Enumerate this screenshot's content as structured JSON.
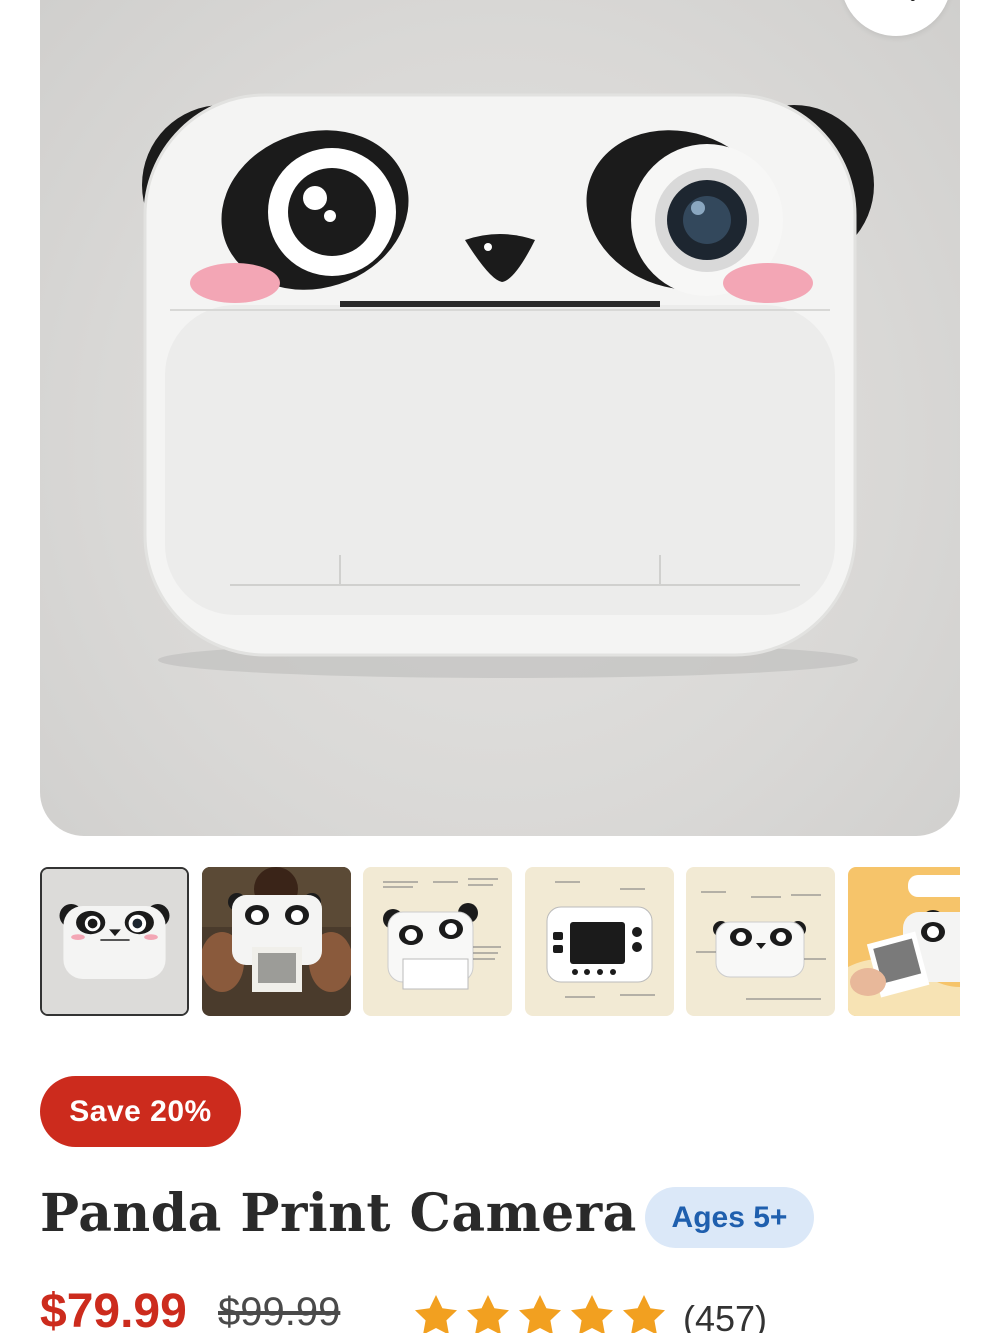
{
  "product": {
    "title": "Panda Print Camera",
    "save_badge": "Save 20%",
    "age_badge": "Ages 5+",
    "price": "$79.99",
    "compare_price": "$99.99",
    "rating": 5,
    "review_count": "(457)"
  },
  "gallery": {
    "thumbnail_count": 6,
    "active_index": 0
  },
  "colors": {
    "sale_red": "#cc2b1d",
    "age_badge_bg": "#dbe8f8",
    "age_badge_text": "#1f5fae",
    "star": "#f2a020"
  },
  "icons": {
    "zoom": "search-icon",
    "rating": "star-icon"
  }
}
